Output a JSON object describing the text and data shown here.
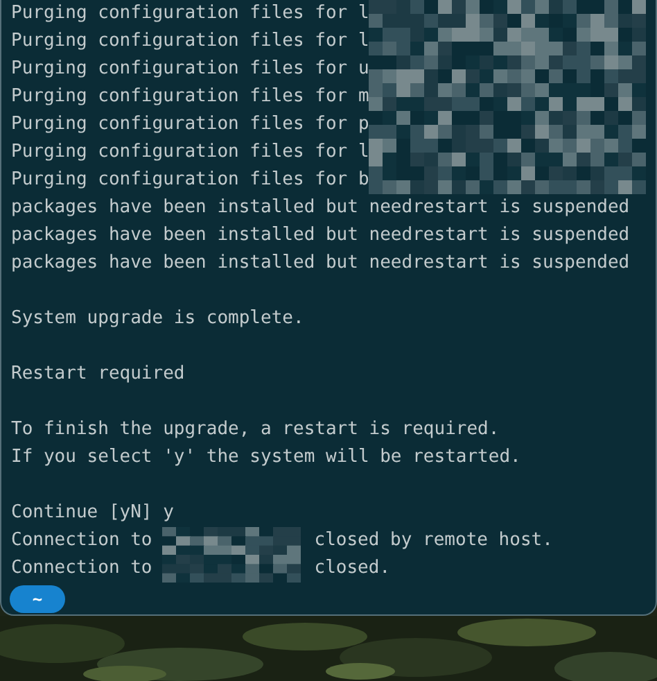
{
  "terminal": {
    "lines": [
      {
        "kind": "redacted_tail",
        "text": "Purging configuration files for l"
      },
      {
        "kind": "redacted_tail",
        "text": "Purging configuration files for l"
      },
      {
        "kind": "redacted_tail",
        "text": "Purging configuration files for u"
      },
      {
        "kind": "redacted_tail",
        "text": "Purging configuration files for m"
      },
      {
        "kind": "redacted_tail",
        "text": "Purging configuration files for p"
      },
      {
        "kind": "redacted_tail",
        "text": "Purging configuration files for l"
      },
      {
        "kind": "redacted_tail",
        "text": "Purging configuration files for b"
      },
      {
        "kind": "text",
        "text": "packages have been installed but needrestart is suspended"
      },
      {
        "kind": "text",
        "text": "packages have been installed but needrestart is suspended"
      },
      {
        "kind": "text",
        "text": "packages have been installed but needrestart is suspended"
      },
      {
        "kind": "blank"
      },
      {
        "kind": "text",
        "text": "System upgrade is complete."
      },
      {
        "kind": "blank"
      },
      {
        "kind": "text",
        "text": "Restart required"
      },
      {
        "kind": "blank"
      },
      {
        "kind": "text",
        "text": "To finish the upgrade, a restart is required."
      },
      {
        "kind": "text",
        "text": "If you select 'y' the system will be restarted."
      },
      {
        "kind": "blank"
      },
      {
        "kind": "text",
        "text": "Continue [yN] y"
      },
      {
        "kind": "redacted_host",
        "before": "Connection to",
        "after": "closed by remote host."
      },
      {
        "kind": "redacted_host",
        "before": "Connection to",
        "after": "closed."
      }
    ],
    "prompt": {
      "label": "~"
    }
  }
}
